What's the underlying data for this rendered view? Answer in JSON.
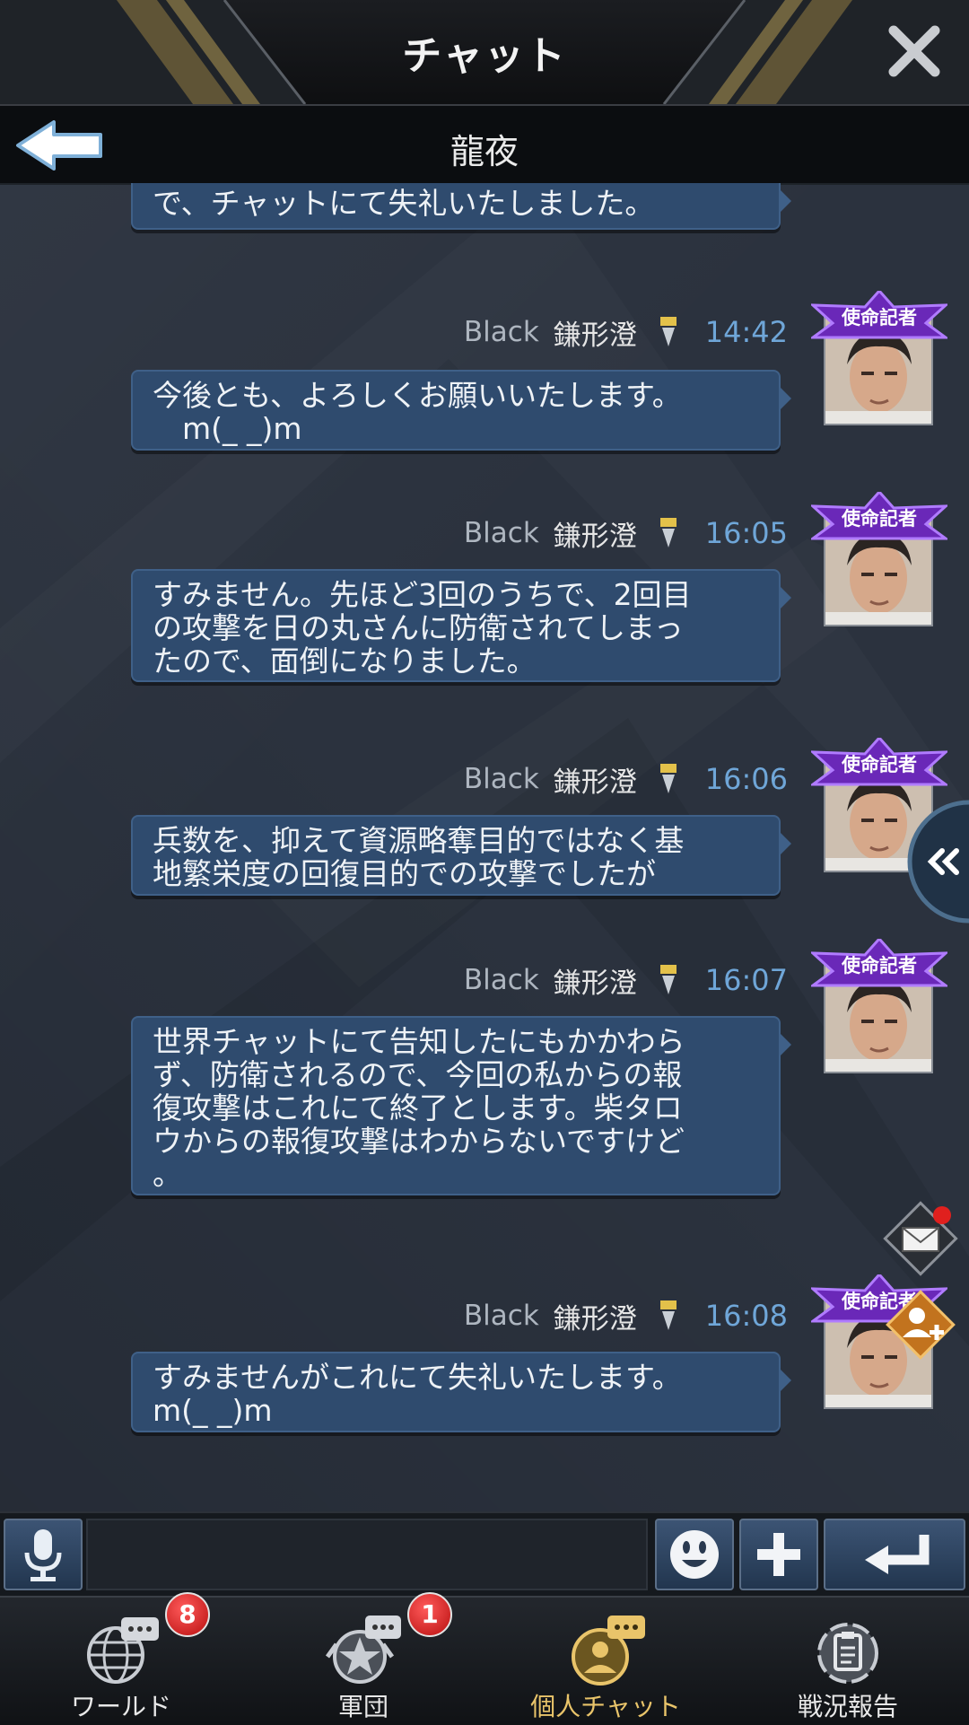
{
  "header": {
    "title": "チャット",
    "close_icon": "close-icon"
  },
  "subheader": {
    "partner_name": "龍夜",
    "back_icon": "back-arrow-icon"
  },
  "messages": [
    {
      "text": "で、チャットにて失礼いたしました。"
    },
    {
      "prefix": "Black",
      "name": "鎌形澄",
      "time": "14:42",
      "badge": "使命記者",
      "text": "今後とも、よろしくお願いいたします。\n　m(_ _)m"
    },
    {
      "prefix": "Black",
      "name": "鎌形澄",
      "time": "16:05",
      "badge": "使命記者",
      "text": "すみません。先ほど3回のうちで、2回目\nの攻撃を日の丸さんに防衛されてしまっ\nたので、面倒になりました。"
    },
    {
      "prefix": "Black",
      "name": "鎌形澄",
      "time": "16:06",
      "badge": "使命記者",
      "text": "兵数を、抑えて資源略奪目的ではなく基\n地繁栄度の回復目的での攻撃でしたが"
    },
    {
      "prefix": "Black",
      "name": "鎌形澄",
      "time": "16:07",
      "badge": "使命記者",
      "text": "世界チャットにて告知したにもかかわら\nず、防衛されるので、今回の私からの報\n復攻撃はこれにて終了とします。柴タロ\nウからの報復攻撃はわからないですけど\n。"
    },
    {
      "prefix": "Black",
      "name": "鎌形澄",
      "time": "16:08",
      "badge": "使命記者",
      "text": "すみませんがこれにて失礼いたします。\nm(_ _)m"
    }
  ],
  "input": {
    "value": "",
    "placeholder": ""
  },
  "input_buttons": {
    "mic_icon": "microphone-icon",
    "emoji_icon": "smiley-icon",
    "plus_icon": "plus-icon",
    "send_icon": "enter-icon"
  },
  "nav": [
    {
      "label": "ワールド",
      "badge": "8",
      "icon": "globe-chat-icon"
    },
    {
      "label": "軍団",
      "badge": "1",
      "icon": "star-chat-icon"
    },
    {
      "label": "個人チャット",
      "badge": "",
      "icon": "person-chat-icon",
      "active": true
    },
    {
      "label": "戦況報告",
      "badge": "",
      "icon": "report-icon"
    }
  ],
  "colors": {
    "bubble": "#2f4b6e",
    "time": "#6fa6d8",
    "active_nav": "#e9c46a",
    "badge": "#d21f1f"
  }
}
